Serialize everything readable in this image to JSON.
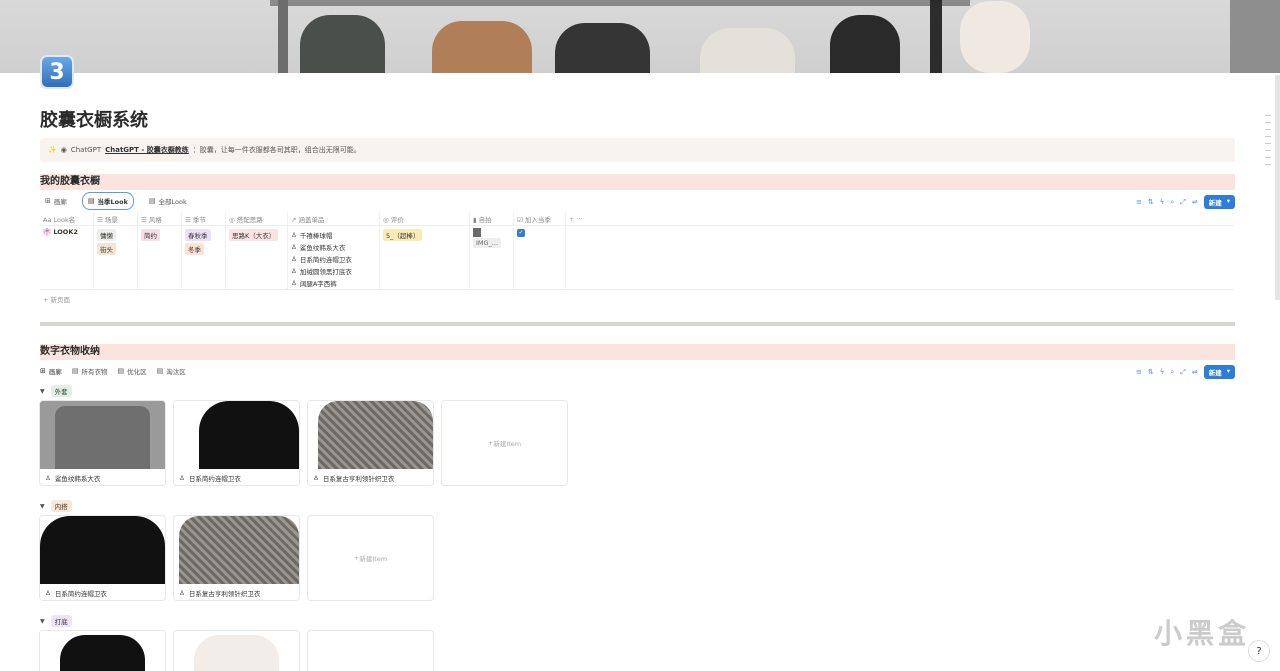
{
  "page": {
    "emoji": "3",
    "title": "胶囊衣橱系统",
    "callout": {
      "ai_label": "ChatGPT",
      "link_text": "ChatGPT - 胶囊衣橱教练",
      "text": "：胶囊，让每一件衣服都各司其职，组合出无限可能。"
    }
  },
  "wardrobe": {
    "heading": "我的胶囊衣橱",
    "tabs": [
      "画廊",
      "当季Look",
      "全部Look"
    ],
    "active_tab": "当季Look",
    "new_button": "新建",
    "columns": [
      "Look名",
      "场景",
      "风格",
      "季节",
      "搭配思路",
      "涵盖单品",
      "评价",
      "自拍",
      "加入当季"
    ],
    "row": {
      "name": "LOOK2",
      "scene": [
        "慵懒",
        "街头"
      ],
      "style": [
        "简约"
      ],
      "season": [
        "春秋季",
        "冬季"
      ],
      "idea": "思路K（大衣）",
      "items": [
        "千禧棒球帽",
        "鲨鱼纹韩系大衣",
        "日系简约连帽卫衣",
        "加绒圆领黑打底衣",
        "阔腿A字西裤"
      ],
      "rating": "5_（超棒）",
      "selfie": "IMG_...",
      "in_season": true
    },
    "new_page": "新页面"
  },
  "storage": {
    "heading": "数字衣物收纳",
    "tabs": [
      "画廊",
      "所有衣物",
      "优化区",
      "淘汰区"
    ],
    "new_button": "新建",
    "groups": [
      {
        "name": "外套",
        "color": "#dff0e4",
        "cards": [
          "鲨鱼纹韩系大衣",
          "日系简约连帽卫衣",
          "日系复古亨利领针织卫衣"
        ],
        "new_item": "新建Item"
      },
      {
        "name": "内搭",
        "color": "#fbe7d6",
        "cards": [
          "日系简约连帽卫衣",
          "日系复古亨利领针织卫衣"
        ],
        "new_item": "新建Item"
      },
      {
        "name": "打底",
        "color": "#ece4f5",
        "cards": [
          "",
          ""
        ],
        "new_item": ""
      }
    ]
  },
  "watermark": "小黑盒"
}
